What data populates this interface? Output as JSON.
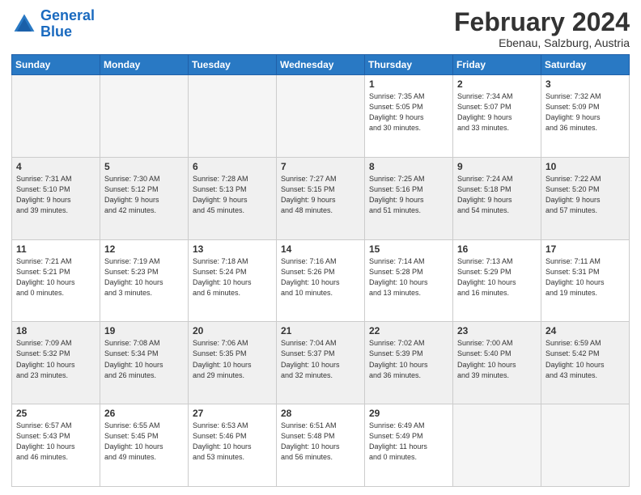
{
  "logo": {
    "line1": "General",
    "line2": "Blue"
  },
  "title": "February 2024",
  "subtitle": "Ebenau, Salzburg, Austria",
  "days_of_week": [
    "Sunday",
    "Monday",
    "Tuesday",
    "Wednesday",
    "Thursday",
    "Friday",
    "Saturday"
  ],
  "weeks": [
    [
      {
        "day": "",
        "info": "",
        "empty": true
      },
      {
        "day": "",
        "info": "",
        "empty": true
      },
      {
        "day": "",
        "info": "",
        "empty": true
      },
      {
        "day": "",
        "info": "",
        "empty": true
      },
      {
        "day": "1",
        "info": "Sunrise: 7:35 AM\nSunset: 5:05 PM\nDaylight: 9 hours\nand 30 minutes.",
        "empty": false
      },
      {
        "day": "2",
        "info": "Sunrise: 7:34 AM\nSunset: 5:07 PM\nDaylight: 9 hours\nand 33 minutes.",
        "empty": false
      },
      {
        "day": "3",
        "info": "Sunrise: 7:32 AM\nSunset: 5:09 PM\nDaylight: 9 hours\nand 36 minutes.",
        "empty": false
      }
    ],
    [
      {
        "day": "4",
        "info": "Sunrise: 7:31 AM\nSunset: 5:10 PM\nDaylight: 9 hours\nand 39 minutes.",
        "empty": false
      },
      {
        "day": "5",
        "info": "Sunrise: 7:30 AM\nSunset: 5:12 PM\nDaylight: 9 hours\nand 42 minutes.",
        "empty": false
      },
      {
        "day": "6",
        "info": "Sunrise: 7:28 AM\nSunset: 5:13 PM\nDaylight: 9 hours\nand 45 minutes.",
        "empty": false
      },
      {
        "day": "7",
        "info": "Sunrise: 7:27 AM\nSunset: 5:15 PM\nDaylight: 9 hours\nand 48 minutes.",
        "empty": false
      },
      {
        "day": "8",
        "info": "Sunrise: 7:25 AM\nSunset: 5:16 PM\nDaylight: 9 hours\nand 51 minutes.",
        "empty": false
      },
      {
        "day": "9",
        "info": "Sunrise: 7:24 AM\nSunset: 5:18 PM\nDaylight: 9 hours\nand 54 minutes.",
        "empty": false
      },
      {
        "day": "10",
        "info": "Sunrise: 7:22 AM\nSunset: 5:20 PM\nDaylight: 9 hours\nand 57 minutes.",
        "empty": false
      }
    ],
    [
      {
        "day": "11",
        "info": "Sunrise: 7:21 AM\nSunset: 5:21 PM\nDaylight: 10 hours\nand 0 minutes.",
        "empty": false
      },
      {
        "day": "12",
        "info": "Sunrise: 7:19 AM\nSunset: 5:23 PM\nDaylight: 10 hours\nand 3 minutes.",
        "empty": false
      },
      {
        "day": "13",
        "info": "Sunrise: 7:18 AM\nSunset: 5:24 PM\nDaylight: 10 hours\nand 6 minutes.",
        "empty": false
      },
      {
        "day": "14",
        "info": "Sunrise: 7:16 AM\nSunset: 5:26 PM\nDaylight: 10 hours\nand 10 minutes.",
        "empty": false
      },
      {
        "day": "15",
        "info": "Sunrise: 7:14 AM\nSunset: 5:28 PM\nDaylight: 10 hours\nand 13 minutes.",
        "empty": false
      },
      {
        "day": "16",
        "info": "Sunrise: 7:13 AM\nSunset: 5:29 PM\nDaylight: 10 hours\nand 16 minutes.",
        "empty": false
      },
      {
        "day": "17",
        "info": "Sunrise: 7:11 AM\nSunset: 5:31 PM\nDaylight: 10 hours\nand 19 minutes.",
        "empty": false
      }
    ],
    [
      {
        "day": "18",
        "info": "Sunrise: 7:09 AM\nSunset: 5:32 PM\nDaylight: 10 hours\nand 23 minutes.",
        "empty": false
      },
      {
        "day": "19",
        "info": "Sunrise: 7:08 AM\nSunset: 5:34 PM\nDaylight: 10 hours\nand 26 minutes.",
        "empty": false
      },
      {
        "day": "20",
        "info": "Sunrise: 7:06 AM\nSunset: 5:35 PM\nDaylight: 10 hours\nand 29 minutes.",
        "empty": false
      },
      {
        "day": "21",
        "info": "Sunrise: 7:04 AM\nSunset: 5:37 PM\nDaylight: 10 hours\nand 32 minutes.",
        "empty": false
      },
      {
        "day": "22",
        "info": "Sunrise: 7:02 AM\nSunset: 5:39 PM\nDaylight: 10 hours\nand 36 minutes.",
        "empty": false
      },
      {
        "day": "23",
        "info": "Sunrise: 7:00 AM\nSunset: 5:40 PM\nDaylight: 10 hours\nand 39 minutes.",
        "empty": false
      },
      {
        "day": "24",
        "info": "Sunrise: 6:59 AM\nSunset: 5:42 PM\nDaylight: 10 hours\nand 43 minutes.",
        "empty": false
      }
    ],
    [
      {
        "day": "25",
        "info": "Sunrise: 6:57 AM\nSunset: 5:43 PM\nDaylight: 10 hours\nand 46 minutes.",
        "empty": false
      },
      {
        "day": "26",
        "info": "Sunrise: 6:55 AM\nSunset: 5:45 PM\nDaylight: 10 hours\nand 49 minutes.",
        "empty": false
      },
      {
        "day": "27",
        "info": "Sunrise: 6:53 AM\nSunset: 5:46 PM\nDaylight: 10 hours\nand 53 minutes.",
        "empty": false
      },
      {
        "day": "28",
        "info": "Sunrise: 6:51 AM\nSunset: 5:48 PM\nDaylight: 10 hours\nand 56 minutes.",
        "empty": false
      },
      {
        "day": "29",
        "info": "Sunrise: 6:49 AM\nSunset: 5:49 PM\nDaylight: 11 hours\nand 0 minutes.",
        "empty": false
      },
      {
        "day": "",
        "info": "",
        "empty": true
      },
      {
        "day": "",
        "info": "",
        "empty": true
      }
    ]
  ]
}
